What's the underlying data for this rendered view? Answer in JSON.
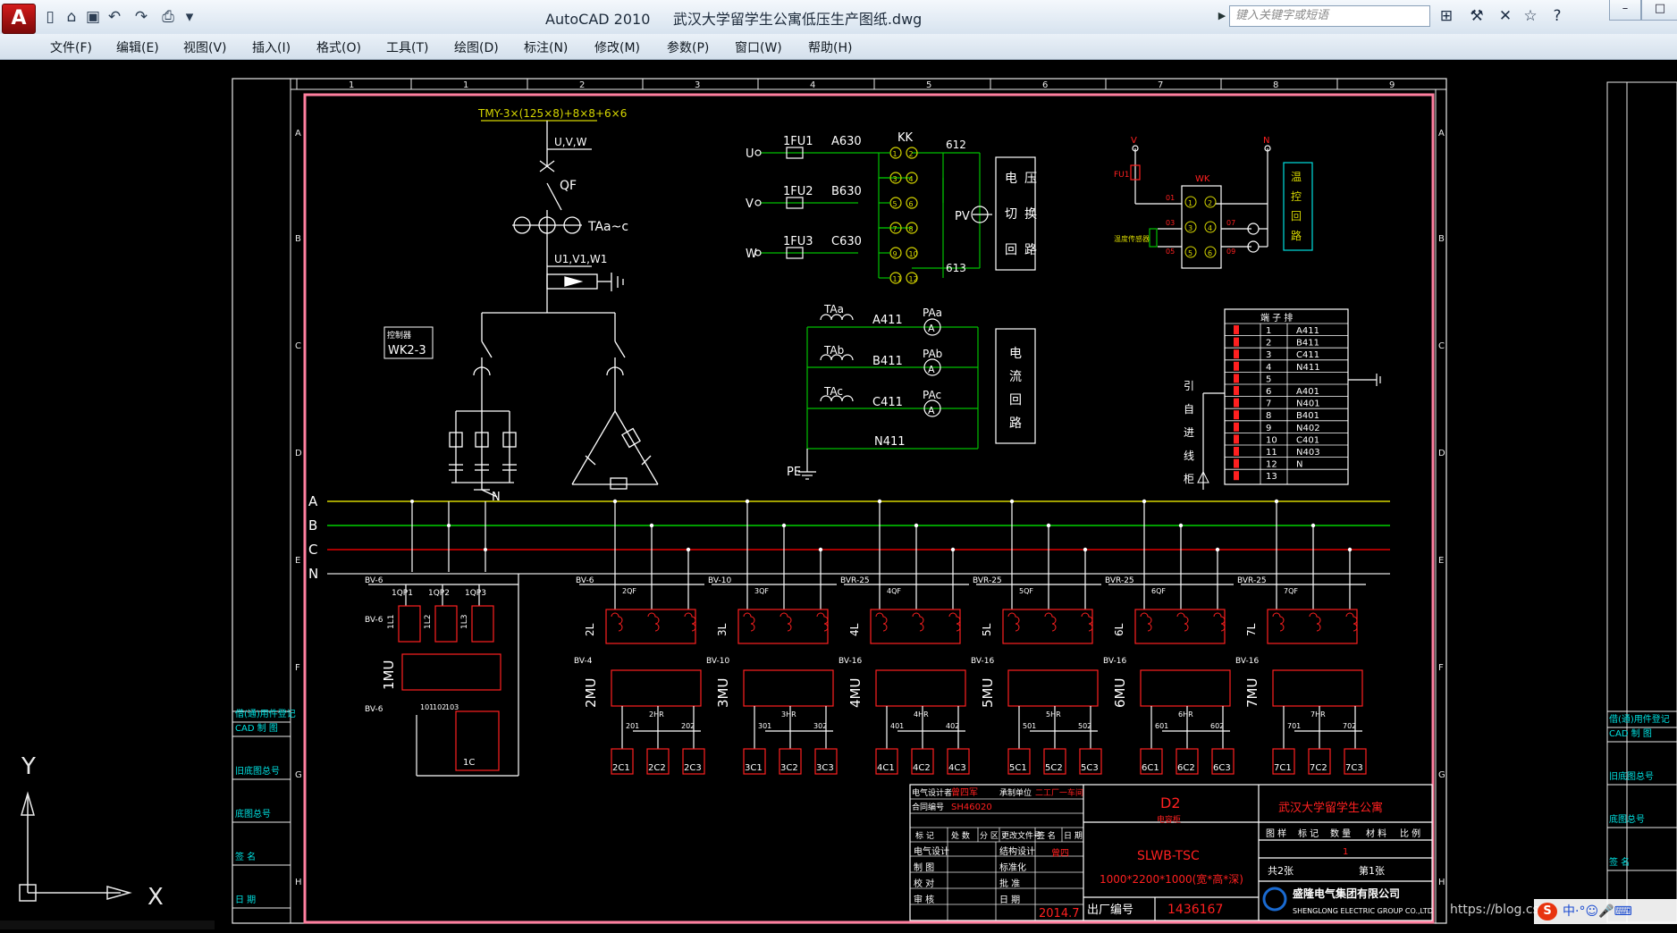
{
  "window": {
    "app_icon": "autocad-a-logo",
    "app_name": "AutoCAD 2010",
    "file_name": "武汉大学留学生公寓低压生产图纸.dwg",
    "search_placeholder": "键入关键字或短语",
    "window_buttons": [
      "–",
      "□",
      "×"
    ]
  },
  "menu": [
    "文件(F)",
    "编辑(E)",
    "视图(V)",
    "插入(I)",
    "格式(O)",
    "工具(T)",
    "绘图(D)",
    "标注(N)",
    "修改(M)",
    "参数(P)",
    "窗口(W)",
    "帮助(H)"
  ],
  "ucs": {
    "x": "X",
    "y": "Y"
  },
  "drawing": {
    "ruler_top": [
      "1",
      "1",
      "2",
      "3",
      "4",
      "5",
      "6",
      "7",
      "8",
      "9"
    ],
    "ruler_side": [
      "A",
      "B",
      "C",
      "D",
      "E",
      "F",
      "G",
      "H"
    ],
    "left_strip": [
      "借(通)用件登记",
      "CAD 制 图",
      "旧底图总号",
      "底图总号",
      "签 名",
      "日 期"
    ],
    "right_strip": [
      "借(通)用件登记",
      "CAD 制 图",
      "旧底图总号",
      "底图总号",
      "签 名"
    ],
    "busbar_spec": "TMY-3×(125×8)+8×8+6×6",
    "uvw": "U,V,W",
    "qf": "QF",
    "ta": "TAa~c",
    "u1v1w1": "U1,V1,W1",
    "controller": [
      "控制器",
      "WK2-3"
    ],
    "n_label": "N",
    "bus": [
      "A",
      "B",
      "C",
      "N"
    ],
    "volt": {
      "phases": [
        "U",
        "V",
        "W"
      ],
      "fuses": [
        "1FU1",
        "1FU2",
        "1FU3"
      ],
      "wires": [
        "A630",
        "B630",
        "C630"
      ],
      "kk": "KK",
      "w612": "612",
      "w613": "613",
      "pv": "PV",
      "kk_pins": [
        "1",
        "2",
        "3",
        "4",
        "5",
        "6",
        "7",
        "8",
        "9",
        "10",
        "11",
        "12"
      ],
      "box": [
        "电",
        "压",
        "切",
        "换",
        "回",
        "路"
      ]
    },
    "curr": {
      "tas": [
        "TAa",
        "TAb",
        "TAc"
      ],
      "wires": [
        "A411",
        "B411",
        "C411"
      ],
      "pas": [
        "PAa",
        "PAb",
        "PAc"
      ],
      "n411": "N411",
      "pe": "PE",
      "box": [
        "电",
        "流",
        "回",
        "路"
      ]
    },
    "ctrl": {
      "v": "V",
      "n": "N",
      "fu": "FU1",
      "wk": "WK",
      "pins_l": [
        "1",
        "3",
        "5"
      ],
      "pins_r": [
        "2",
        "4",
        "6"
      ],
      "wires": [
        "01",
        "03",
        "05",
        "07",
        "09"
      ],
      "sensor": "温度传感器",
      "box": [
        "温",
        "控",
        "回",
        "路"
      ]
    },
    "terminal": {
      "header": "端 子 排",
      "rows": [
        [
          "1",
          "A411"
        ],
        [
          "2",
          "B411"
        ],
        [
          "3",
          "C411"
        ],
        [
          "4",
          "N411"
        ],
        [
          "5",
          ""
        ],
        [
          "6",
          "A401"
        ],
        [
          "7",
          "N401"
        ],
        [
          "8",
          "B401"
        ],
        [
          "9",
          "N402"
        ],
        [
          "10",
          "C401"
        ],
        [
          "11",
          "N403"
        ],
        [
          "12",
          "N"
        ],
        [
          "13",
          ""
        ]
      ],
      "side": [
        "引",
        "自",
        "进",
        "线",
        "柜"
      ]
    },
    "feeder_top": {
      "bv6": "BV-6",
      "qps": [
        "1QP1",
        "1QP2",
        "1QP3"
      ],
      "ls": [
        "1L1",
        "1L2",
        "1L3"
      ],
      "mu": "1MU",
      "hrs": [
        "101",
        "102",
        "103"
      ],
      "cap": "1C"
    },
    "groups": [
      {
        "q": "2QF",
        "l": "2L",
        "mu": "2MU",
        "hr": "2HR",
        "t": [
          "201",
          "202"
        ],
        "c": [
          "2C1",
          "2C2",
          "2C3"
        ],
        "w1": "BV-6",
        "w2": "BV-4"
      },
      {
        "q": "3QF",
        "l": "3L",
        "mu": "3MU",
        "hr": "3HR",
        "t": [
          "301",
          "302"
        ],
        "c": [
          "3C1",
          "3C2",
          "3C3"
        ],
        "w1": "BV-10",
        "w2": "BV-10"
      },
      {
        "q": "4QF",
        "l": "4L",
        "mu": "4MU",
        "hr": "4HR",
        "t": [
          "401",
          "402"
        ],
        "c": [
          "4C1",
          "4C2",
          "4C3"
        ],
        "w1": "BVR-25",
        "w2": "BV-16"
      },
      {
        "q": "5QF",
        "l": "5L",
        "mu": "5MU",
        "hr": "5HR",
        "t": [
          "501",
          "502"
        ],
        "c": [
          "5C1",
          "5C2",
          "5C3"
        ],
        "w1": "BVR-25",
        "w2": "BV-16"
      },
      {
        "q": "6QF",
        "l": "6L",
        "mu": "6MU",
        "hr": "6HR",
        "t": [
          "601",
          "602"
        ],
        "c": [
          "6C1",
          "6C2",
          "6C3"
        ],
        "w1": "BVR-25",
        "w2": "BV-16"
      },
      {
        "q": "7QF",
        "l": "7L",
        "mu": "7MU",
        "hr": "7HR",
        "t": [
          "701",
          "702"
        ],
        "c": [
          "7C1",
          "7C2",
          "7C3"
        ],
        "w1": "BVR-25",
        "w2": "BV-16"
      }
    ],
    "title_block": {
      "designer_label": "电气设计者",
      "designer": "曾四军",
      "contract_label": "合同编号",
      "contract": "SH46020",
      "maker_label": "承制单位",
      "maker": "二工厂一车间",
      "cols": [
        "标 记",
        "处 数",
        "分 区",
        "更改文件号",
        "签 名",
        "日 期"
      ],
      "rows_left": [
        "电气设计",
        "制 图",
        "校 对",
        "审 核"
      ],
      "rows_mid": [
        "结构设计",
        "标准化",
        "批 准",
        "日 期"
      ],
      "sign": "曾四",
      "date": "2014.7",
      "model": "D2",
      "model_sub": "电容柜",
      "product": "SLWB-TSC",
      "size": "1000*2200*1000(宽*高*深)",
      "serial_label": "出厂编号",
      "serial": "1436167",
      "project": "武汉大学留学生公寓",
      "info_cols": [
        "图 样",
        "标 记",
        "数 量",
        "材 料",
        "比 例"
      ],
      "sheet_total": "共2张",
      "sheet_no": "第1张",
      "company": "盛隆电气集团有限公司",
      "company_en": "SHENGLONG ELECTRIC GROUP CO.,LTD"
    }
  },
  "watermark": "https://blog.cs",
  "tray": {
    "ime_logo": "S",
    "ime_text": "中·°☺🎤⌨"
  },
  "colors": {
    "bus_a": "#d6d600",
    "bus_b": "#00d000",
    "bus_c": "#e00000",
    "frame": "#ff7f9f",
    "wire": "#ffffff",
    "cyan": "#00e0e0",
    "red": "#ff2020",
    "green": "#00c000"
  }
}
